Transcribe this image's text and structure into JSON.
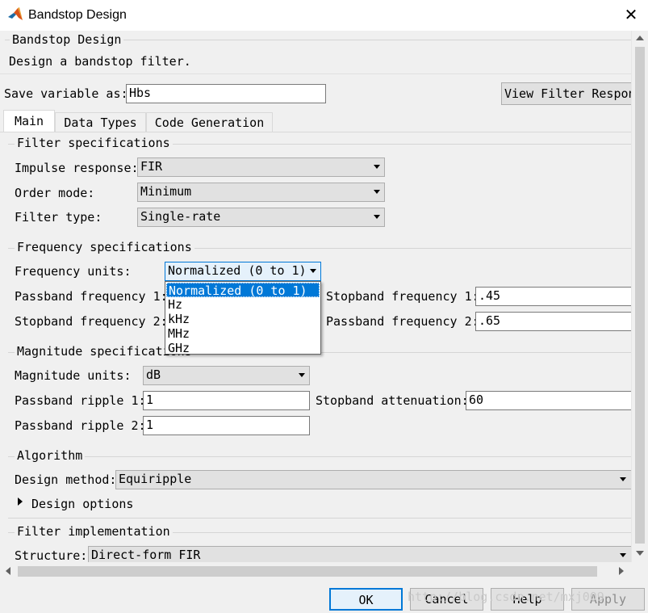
{
  "window": {
    "title": "Bandstop Design",
    "close_glyph": "✕"
  },
  "header": {
    "group_title": "Bandstop Design",
    "description": "Design a bandstop filter."
  },
  "save": {
    "label": "Save variable as:",
    "value": "Hbs",
    "view_button": "View Filter Response"
  },
  "tabs": [
    {
      "label": "Main",
      "active": true
    },
    {
      "label": "Data Types",
      "active": false
    },
    {
      "label": "Code Generation",
      "active": false
    }
  ],
  "filter_specs": {
    "title": "Filter specifications",
    "impulse_label": "Impulse response:",
    "impulse_value": "FIR",
    "order_label": "Order mode:",
    "order_value": "Minimum",
    "type_label": "Filter type:",
    "type_value": "Single-rate"
  },
  "freq_specs": {
    "title": "Frequency specifications",
    "units_label": "Frequency units:",
    "units_value": "Normalized (0 to 1)",
    "pass1_label": "Passband frequency 1:",
    "stop1_label": "Stopband frequency 1:",
    "stop1_value": ".45",
    "stop2_label": "Stopband frequency 2:",
    "pass2_label": "Passband frequency 2:",
    "pass2_value": ".65",
    "dropdown_options": [
      "Normalized (0 to 1)",
      "Hz",
      "kHz",
      "MHz",
      "GHz"
    ]
  },
  "mag_specs": {
    "title": "Magnitude specifications",
    "units_label": "Magnitude units:",
    "units_value": "dB",
    "ripple1_label": "Passband ripple 1:",
    "ripple1_value": "1",
    "atten_label": "Stopband attenuation:",
    "atten_value": "60",
    "ripple2_label": "Passband ripple 2:",
    "ripple2_value": "1"
  },
  "algorithm": {
    "title": "Algorithm",
    "method_label": "Design method:",
    "method_value": "Equiripple",
    "options_label": "Design options"
  },
  "implementation": {
    "title": "Filter implementation",
    "structure_label": "Structure:",
    "structure_value": "Direct-form FIR"
  },
  "buttons": {
    "ok": "OK",
    "cancel": "Cancel",
    "help": "Help",
    "apply": "Apply"
  },
  "watermark": "http://blog.csdn.net/mxj009",
  "colors": {
    "selection": "#0078d7",
    "matlab_logo": "#d95319"
  }
}
